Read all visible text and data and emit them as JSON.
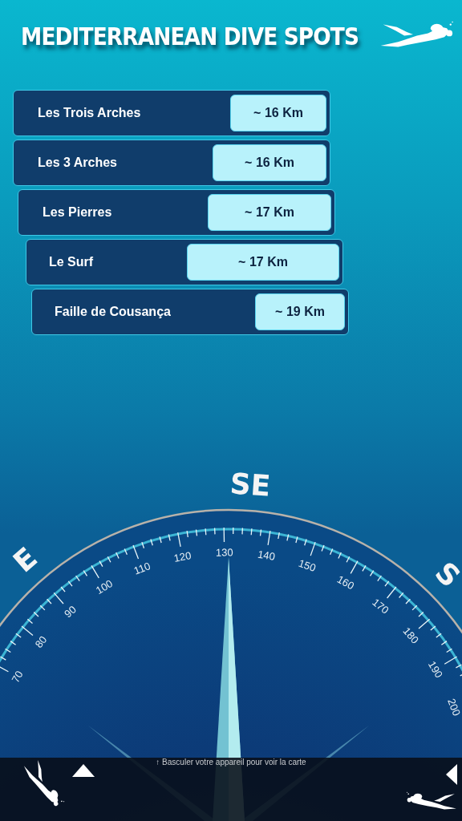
{
  "header": {
    "title": "MEDITERRANEAN DIVE SPOTS"
  },
  "spots": [
    {
      "name": "Les Trois Arches",
      "distance": "~ 16 Km"
    },
    {
      "name": "Les 3 Arches",
      "distance": "~ 16 Km"
    },
    {
      "name": "Les Pierres",
      "distance": "~ 17 Km"
    },
    {
      "name": "Le Surf",
      "distance": "~ 17 Km"
    },
    {
      "name": "Faille de Cousança",
      "distance": "~ 19 Km"
    }
  ],
  "compass": {
    "directions": [
      {
        "label": "E"
      },
      {
        "label": "SE"
      },
      {
        "label": "S"
      }
    ],
    "scale_labels": [
      "70",
      "80",
      "90",
      "100",
      "110",
      "120",
      "130",
      "140",
      "150",
      "160",
      "170",
      "180",
      "190",
      "200"
    ]
  },
  "bottom_bar": {
    "hint": "↑ Basculer votre appareil pour voir la carte"
  }
}
